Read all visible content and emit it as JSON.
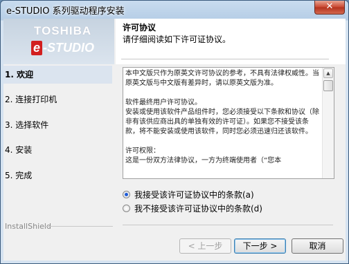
{
  "window": {
    "title": "e-STUDIO 系列驱动程序安装",
    "close_glyph": "✕"
  },
  "logo": {
    "brand": "TOSHIBA",
    "product_e": "e",
    "product_rest": "-STUDIO"
  },
  "steps": [
    {
      "label": "1. 欢迎",
      "active": true
    },
    {
      "label": "2. 连接打印机",
      "active": false
    },
    {
      "label": "3. 选择软件",
      "active": false
    },
    {
      "label": "4. 安装",
      "active": false
    },
    {
      "label": "5. 完成",
      "active": false
    }
  ],
  "footer_brand": "InstallShield",
  "header": {
    "title": "许可协议",
    "subtitle": "请仔细阅读如下许可证协议。"
  },
  "license_text": "本中文版只作为原英文许可协议的参考，不具有法律权威性。当原英文版与中文版有差异时，请以原英文版为准。\n\n软件最终用户许可协议。\n安装或使用该软件产品组件时，您必须接受以下条款和协议（除非有该供应商出具的单独有效的许可证）。如果您不接受该条款，将不能安装或使用该软件，同时您必须迅速归还该软件。\n\n许可权限：\n这是一份双方法律协议，一方为终端使用者（“您本",
  "scroll_up_icon": "▲",
  "options": {
    "accept": {
      "label": "我接受该许可证协议中的条款(a)",
      "checked": true
    },
    "decline": {
      "label": "我不接受该许可证协议中的条款(d)",
      "checked": false
    }
  },
  "buttons": {
    "back": "< 上一步",
    "next": "下一步 >",
    "cancel": "取消"
  }
}
